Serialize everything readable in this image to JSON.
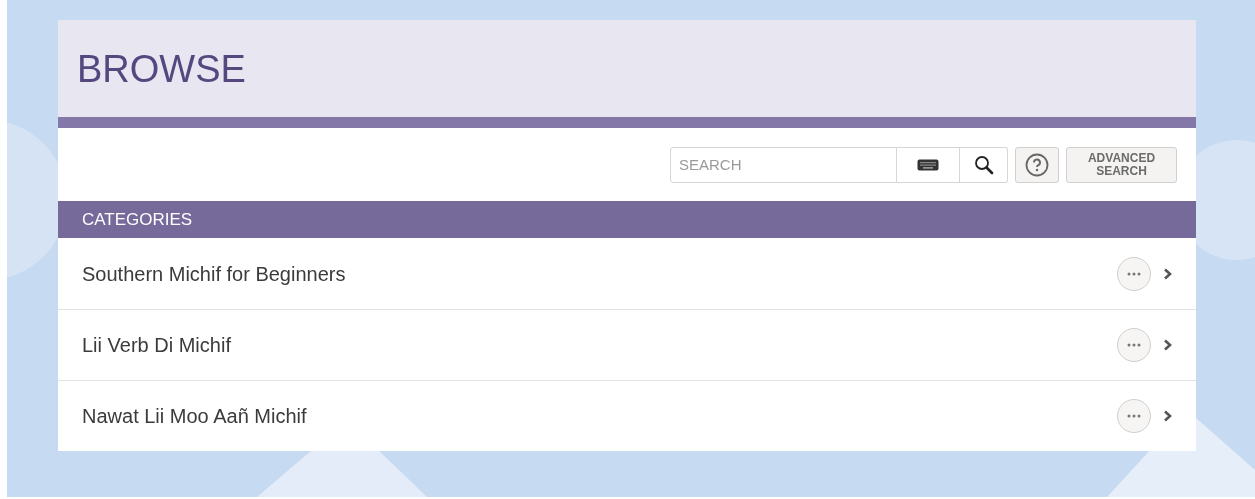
{
  "header": {
    "title": "BROWSE"
  },
  "search": {
    "placeholder": "SEARCH",
    "advanced_label": "ADVANCED SEARCH"
  },
  "categories": {
    "heading": "CATEGORIES",
    "items": [
      {
        "label": "Southern Michif for Beginners"
      },
      {
        "label": "Lii Verb Di Michif"
      },
      {
        "label": "Nawat Lii Moo Aañ Michif"
      }
    ]
  }
}
